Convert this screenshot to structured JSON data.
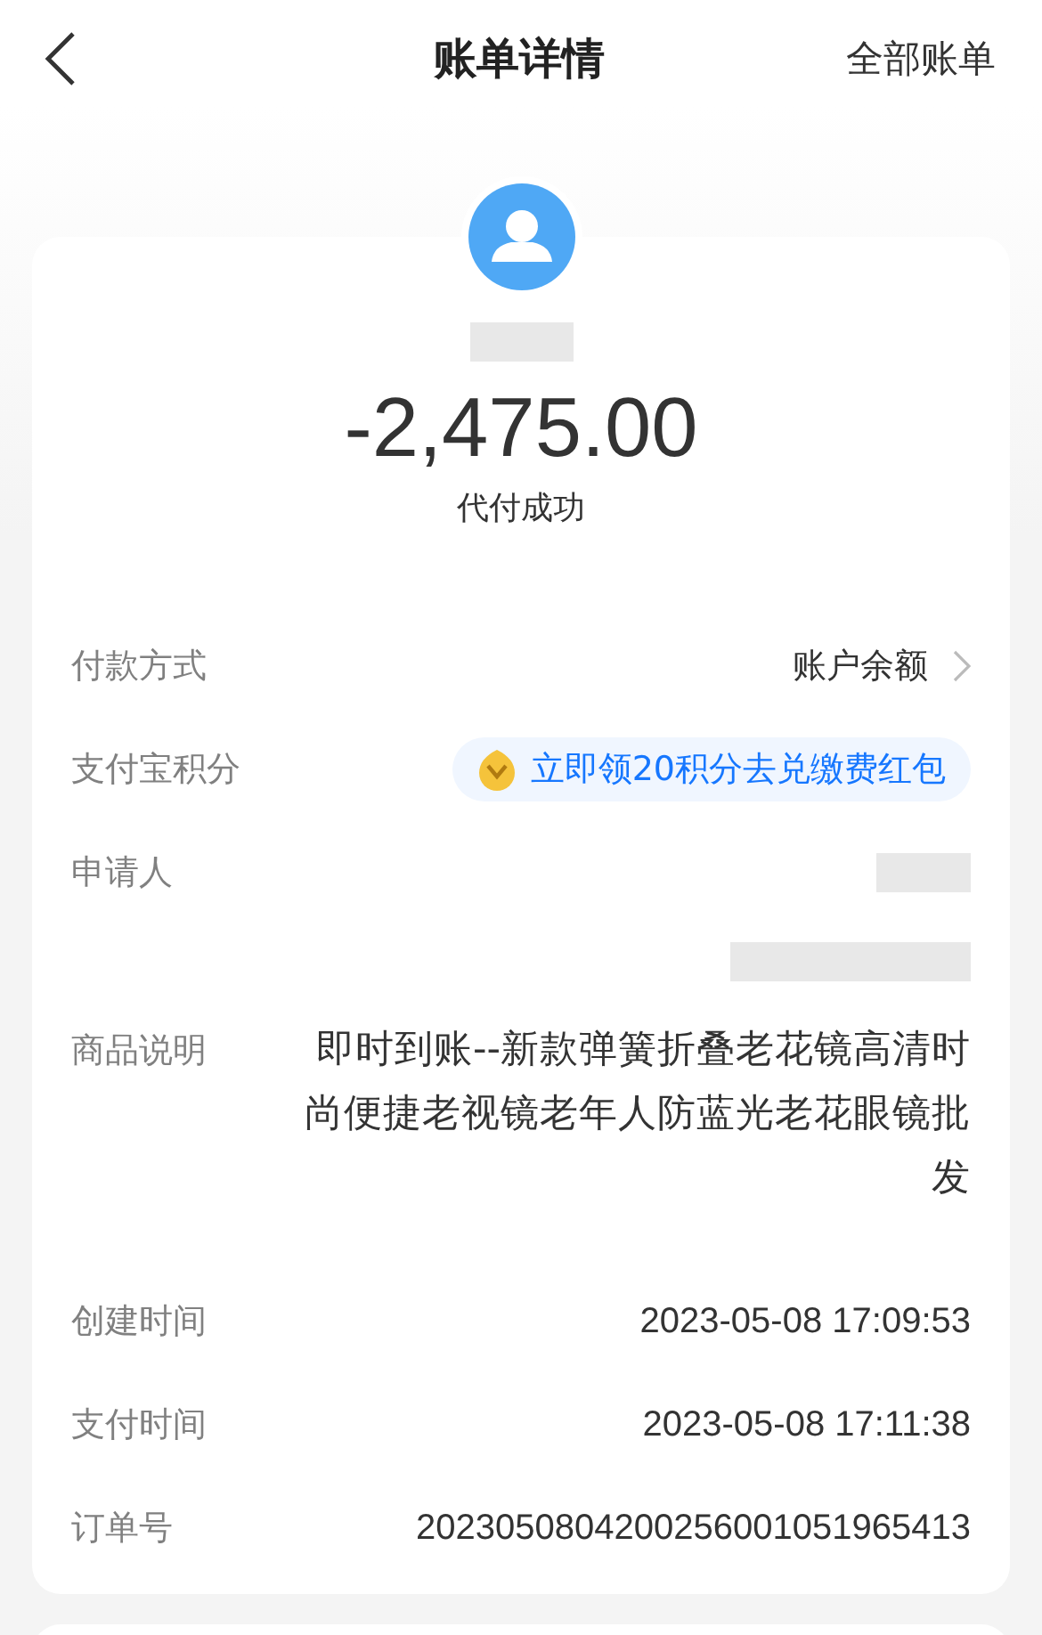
{
  "header": {
    "title": "账单详情",
    "action": "全部账单"
  },
  "summary": {
    "amount": "-2,475.00",
    "status": "代付成功"
  },
  "rows": [
    {
      "kind": "link",
      "label": "付款方式",
      "value": "账户余额"
    },
    {
      "kind": "badge",
      "label": "支付宝积分",
      "value": "立即领20积分去兑缴费红包"
    },
    {
      "kind": "redacted",
      "label": "申请人"
    },
    {
      "kind": "redacted_line"
    },
    {
      "kind": "text",
      "label": "商品说明",
      "value": "即时到账--新款弹簧折叠老花镜高清时尚便捷老视镜老年人防蓝光老花眼镜批发"
    },
    {
      "kind": "text",
      "label": "创建时间",
      "value": "2023-05-08 17:09:53"
    },
    {
      "kind": "text",
      "label": "支付时间",
      "value": "2023-05-08 17:11:38"
    },
    {
      "kind": "text",
      "label": "订单号",
      "value": "2023050804200256001051965413"
    }
  ]
}
